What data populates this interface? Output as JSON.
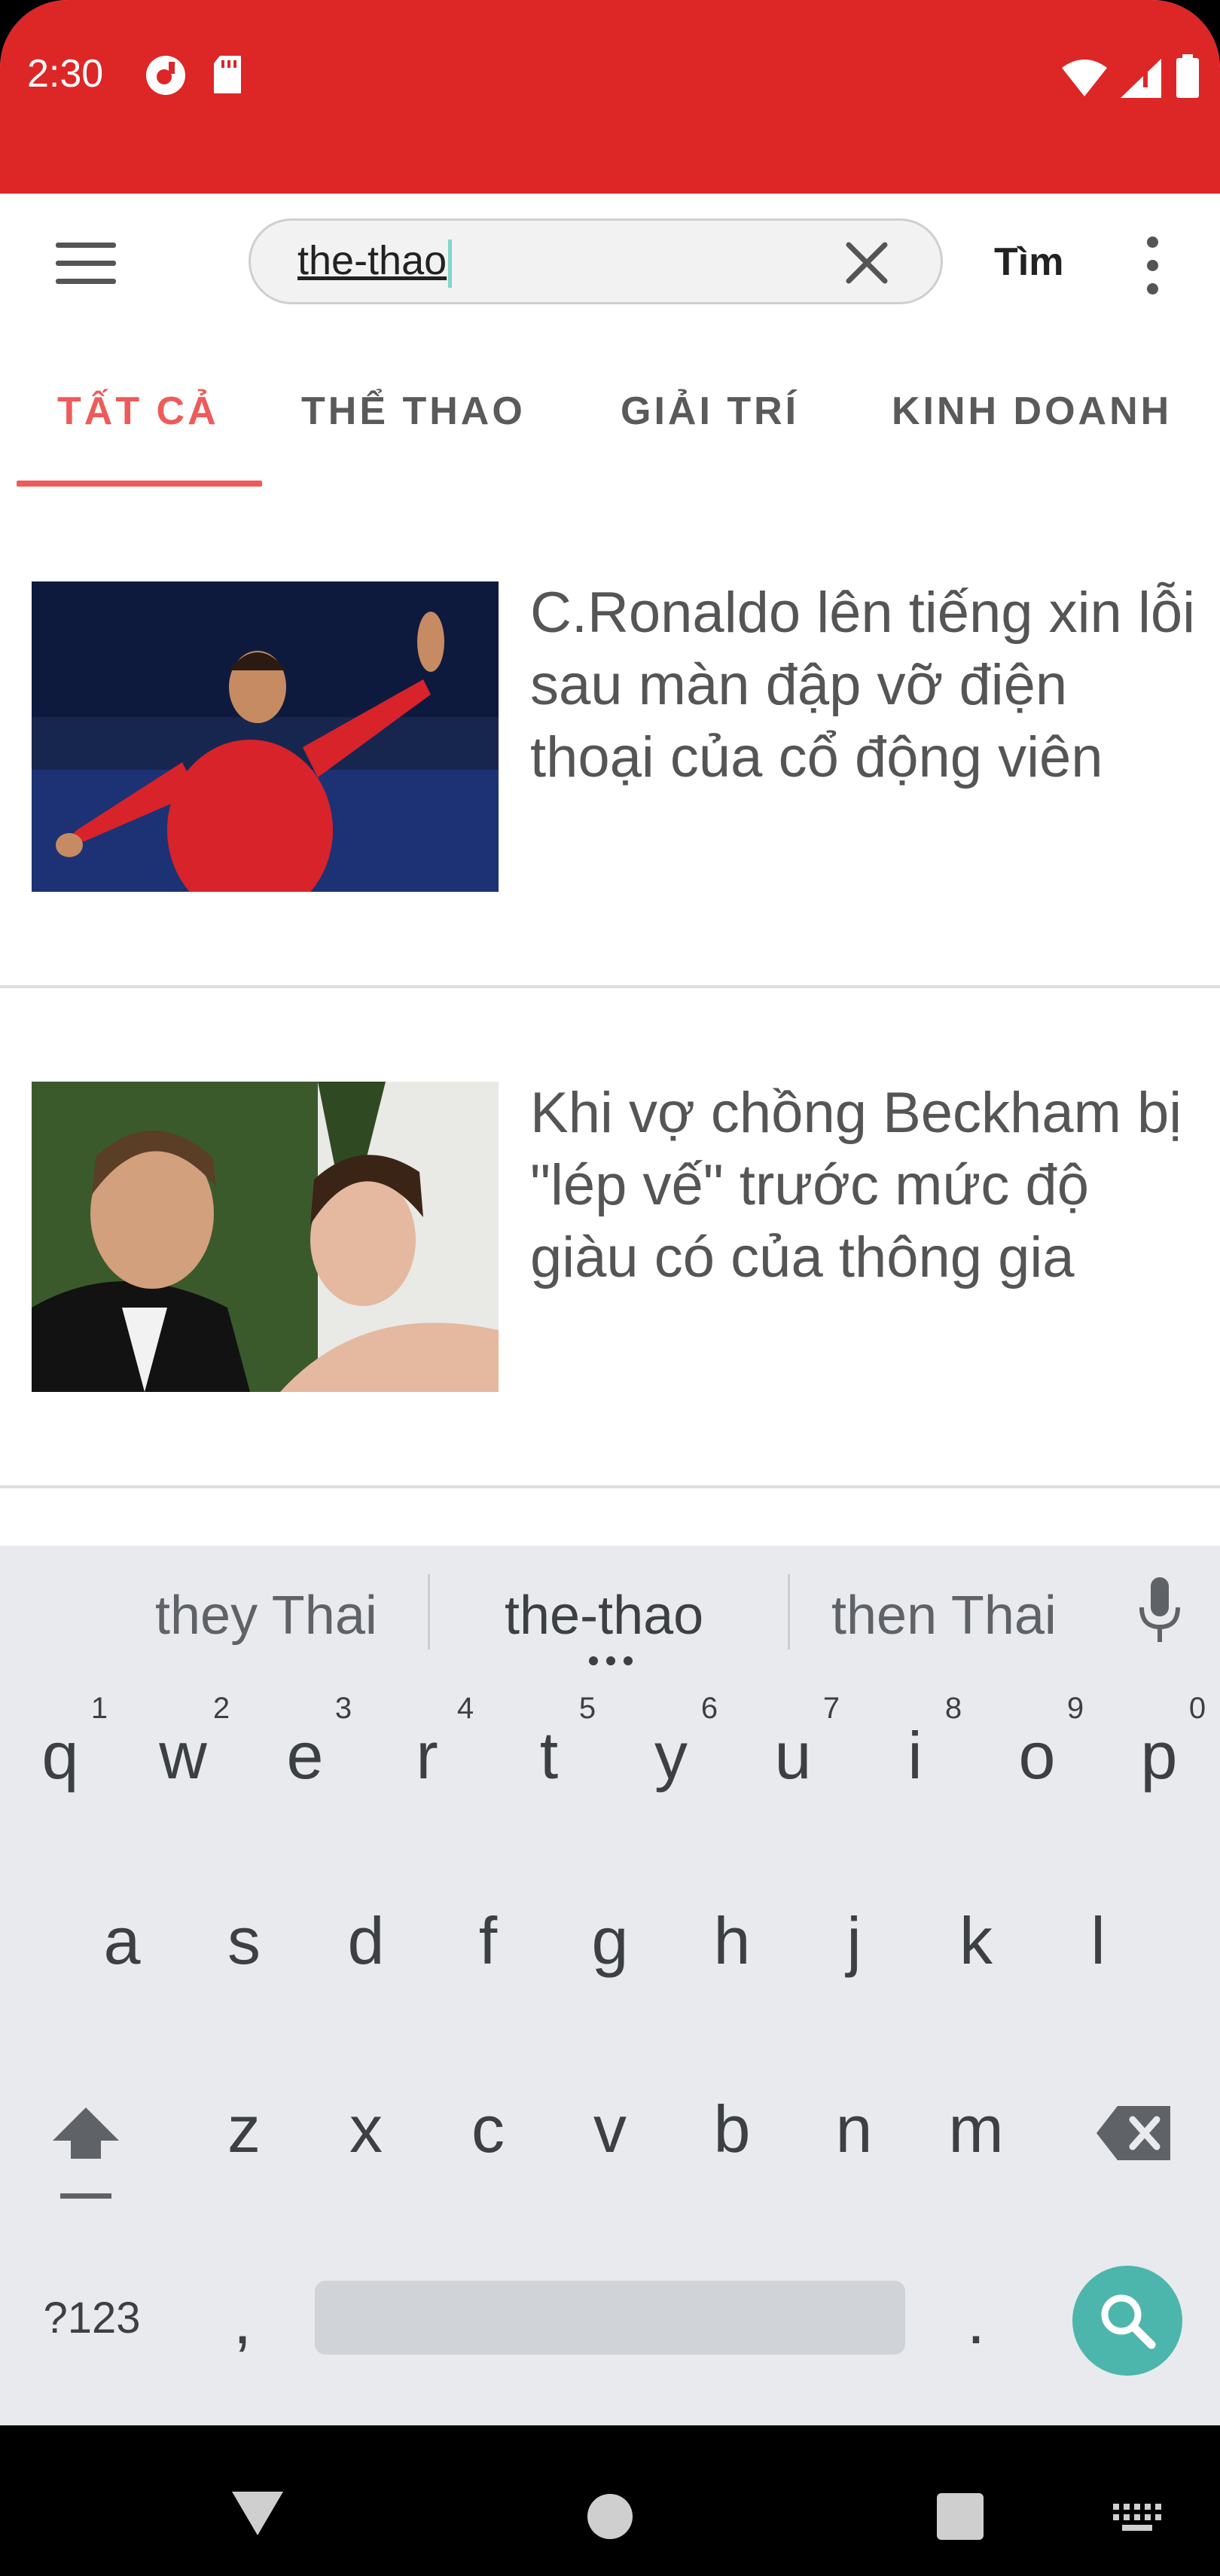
{
  "status_bar": {
    "time": "2:30",
    "color": "#dd2626"
  },
  "search": {
    "query": "the-thao",
    "button_label": "Tìm"
  },
  "tabs": [
    {
      "label": "TẤT CẢ",
      "active": true
    },
    {
      "label": "THỂ THAO",
      "active": false
    },
    {
      "label": "GIẢI TRÍ",
      "active": false
    },
    {
      "label": "KINH DOANH",
      "active": false
    }
  ],
  "news": [
    {
      "title": "C.Ronaldo lên tiếng xin lỗi sau màn đập vỡ điện thoại của cổ động viên"
    },
    {
      "title": "Khi vợ chồng Beckham bị \"lép vế\" trước mức độ giàu có của thông gia"
    }
  ],
  "keyboard": {
    "suggestions": [
      "they Thai",
      "the-thao",
      "then Thai"
    ],
    "row1": [
      "q",
      "w",
      "e",
      "r",
      "t",
      "y",
      "u",
      "i",
      "o",
      "p"
    ],
    "row1_hints": [
      "1",
      "2",
      "3",
      "4",
      "5",
      "6",
      "7",
      "8",
      "9",
      "0"
    ],
    "row2": [
      "a",
      "s",
      "d",
      "f",
      "g",
      "h",
      "j",
      "k",
      "l"
    ],
    "row3": [
      "z",
      "x",
      "c",
      "v",
      "b",
      "n",
      "m"
    ],
    "symbols_key": "?123",
    "comma": ",",
    "period": "."
  },
  "colors": {
    "accent": "#ef5a5a",
    "keyboard_action": "#4db6ac"
  }
}
